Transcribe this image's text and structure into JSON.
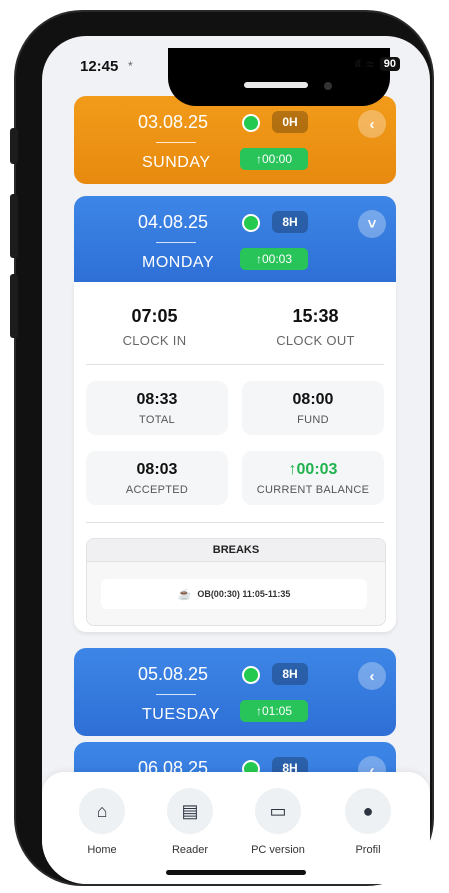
{
  "status": {
    "time": "12:45",
    "extra": "*",
    "signal": "ıll",
    "wifi": "≈",
    "battery": "90"
  },
  "days": [
    {
      "date": "03.08.25",
      "weekday": "SUNDAY",
      "hours": "0H",
      "balance": "↑00:00",
      "chevron": "‹"
    },
    {
      "date": "04.08.25",
      "weekday": "MONDAY",
      "hours": "8H",
      "balance": "↑00:03",
      "chevron": "˅"
    },
    {
      "date": "05.08.25",
      "weekday": "TUESDAY",
      "hours": "8H",
      "balance": "↑01:05",
      "chevron": "‹"
    },
    {
      "date": "06.08.25",
      "hours": "8H",
      "chevron": "‹"
    }
  ],
  "detail": {
    "clock_in": {
      "value": "07:05",
      "label": "CLOCK IN"
    },
    "clock_out": {
      "value": "15:38",
      "label": "CLOCK OUT"
    },
    "total": {
      "value": "08:33",
      "label": "TOTAL"
    },
    "fund": {
      "value": "08:00",
      "label": "FUND"
    },
    "accepted": {
      "value": "08:03",
      "label": "ACCEPTED"
    },
    "current_balance": {
      "value": "↑00:03",
      "label": "CURRENT BALANCE"
    },
    "breaks_title": "BREAKS",
    "break_item": "OB(00:30) 11:05-11:35"
  },
  "nav": [
    {
      "label": "Home",
      "icon": "⌂"
    },
    {
      "label": "Reader",
      "icon": "▤"
    },
    {
      "label": "PC version",
      "icon": "▭"
    },
    {
      "label": "Profil",
      "icon": "●"
    }
  ],
  "colors": {
    "orange": "#f29b1a",
    "blue": "#3d86e6",
    "green": "#28c45a"
  }
}
